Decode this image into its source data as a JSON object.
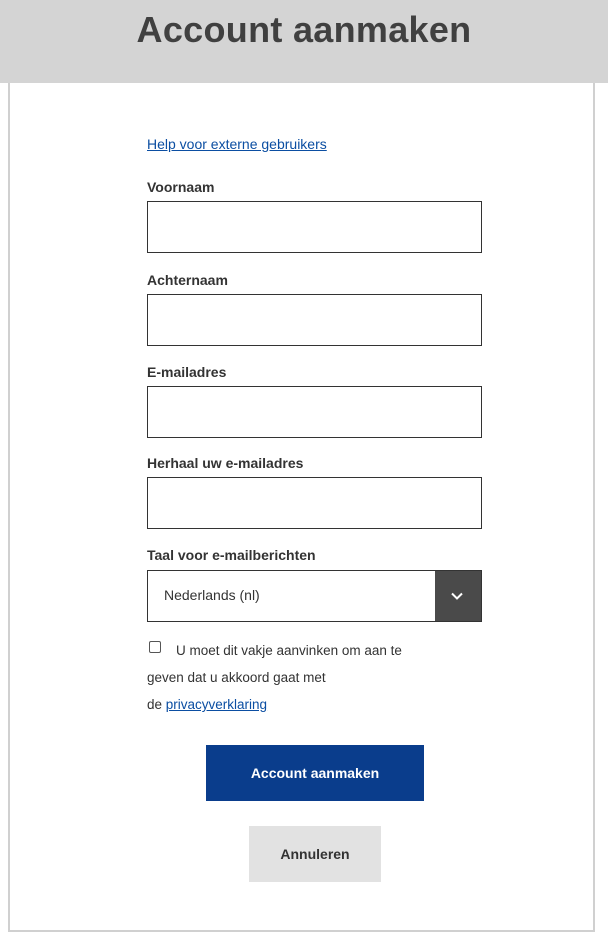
{
  "header": {
    "title": "Account aanmaken"
  },
  "form": {
    "help_link": "Help voor externe gebruikers",
    "first_name": {
      "label": "Voornaam",
      "value": ""
    },
    "last_name": {
      "label": "Achternaam",
      "value": ""
    },
    "email": {
      "label": "E-mailadres",
      "value": ""
    },
    "email_repeat": {
      "label": "Herhaal uw e-mailadres",
      "value": ""
    },
    "language": {
      "label": "Taal voor e-mailberichten",
      "selected": "Nederlands (nl)"
    },
    "consent": {
      "checked": false,
      "line1": "U moet dit vakje aanvinken om aan te",
      "line2": "geven dat u akkoord gaat met",
      "line3_prefix": "de ",
      "link": "privacyverklaring"
    },
    "submit_label": "Account aanmaken",
    "cancel_label": "Annuleren"
  },
  "colors": {
    "header_bg": "#d4d4d4",
    "primary": "#0a3d8c",
    "link": "#0b4ea2",
    "secondary_bg": "#e2e2e2"
  }
}
